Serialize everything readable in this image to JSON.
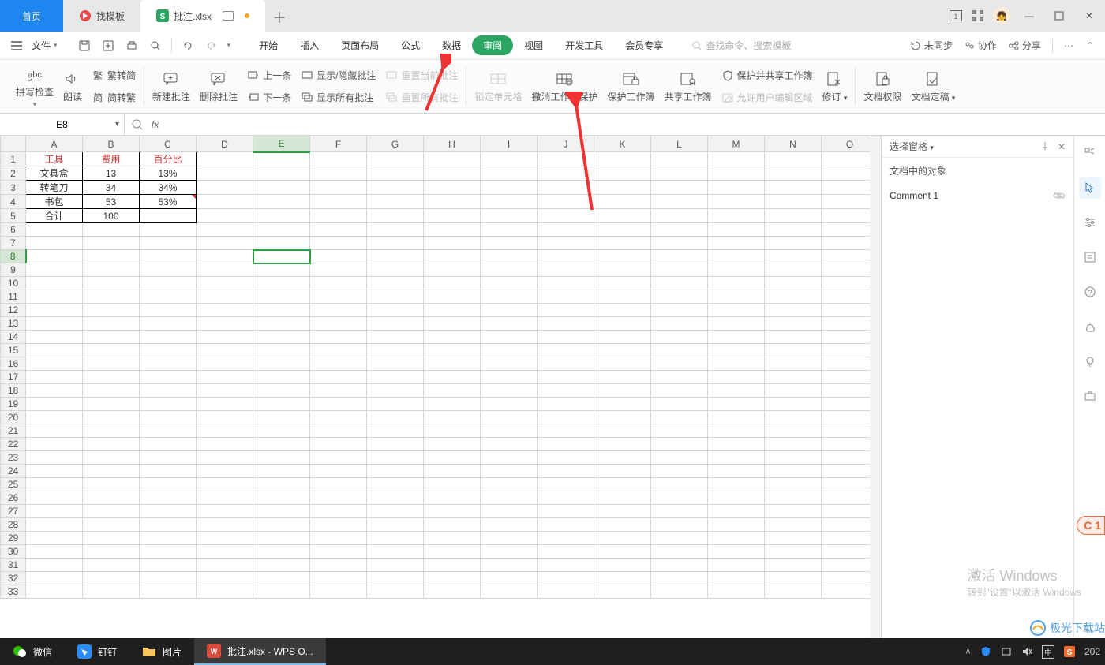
{
  "tabs": {
    "home": "首页",
    "template": "找模板",
    "file": "批注.xlsx"
  },
  "menubar": {
    "file": "文件",
    "items": [
      "开始",
      "插入",
      "页面布局",
      "公式",
      "数据",
      "审阅",
      "视图",
      "开发工具",
      "会员专享"
    ],
    "active_index": 5,
    "search_placeholder": "查找命令、搜索模板",
    "right": {
      "unsync": "未同步",
      "coop": "协作",
      "share": "分享"
    }
  },
  "ribbon": {
    "spellcheck": "拼写检查",
    "read": "朗读",
    "t2s_top": "繁转简",
    "t2s_bot": "简转繁",
    "new_comment": "新建批注",
    "del_comment": "删除批注",
    "prev": "上一条",
    "next": "下一条",
    "showhide": "显示/隐藏批注",
    "showall": "显示所有批注",
    "reset_current": "重置当前批注",
    "reset_all": "重置所有批注",
    "lock_cell": "锁定单元格",
    "unprotect_sheet": "撤消工作表保护",
    "protect_wb": "保护工作簿",
    "share_wb": "共享工作簿",
    "protect_share": "保护并共享工作簿",
    "allow_edit": "允许用户编辑区域",
    "track": "修订",
    "doc_perm": "文档权限",
    "doc_final": "文档定稿"
  },
  "namebox": "E8",
  "columns": [
    "A",
    "B",
    "C",
    "D",
    "E",
    "F",
    "G",
    "H",
    "I",
    "J",
    "K",
    "L",
    "M",
    "N",
    "O"
  ],
  "selected_col": "E",
  "selected_row": 8,
  "row_count": 33,
  "table": {
    "headers": [
      "工具",
      "费用",
      "百分比"
    ],
    "rows": [
      [
        "文具盒",
        "13",
        "13%"
      ],
      [
        "转笔刀",
        "34",
        "34%"
      ],
      [
        "书包",
        "53",
        "53%"
      ],
      [
        "合计",
        "100",
        ""
      ]
    ]
  },
  "right_panel": {
    "title": "选择窗格",
    "subtitle": "文档中的对象",
    "items": [
      "Comment 1"
    ]
  },
  "taskbar": {
    "wechat": "微信",
    "dingtalk": "钉钉",
    "pictures": "图片",
    "wps": "批注.xlsx - WPS O...",
    "clock": "202"
  },
  "watermark": {
    "line1": "激活 Windows",
    "line2": "转到\"设置\"以激活 Windows"
  },
  "brand": "极光下载站",
  "badge": "C 1"
}
